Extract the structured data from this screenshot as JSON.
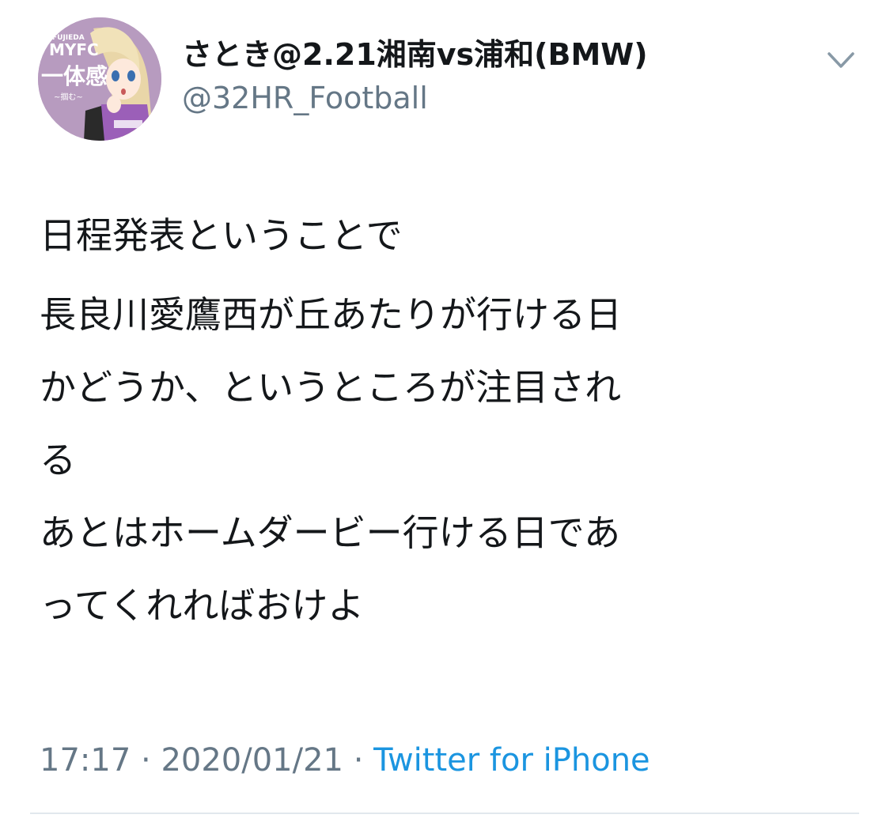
{
  "author": {
    "display_name": "さとき@2.21湘南vs浦和(BMW)",
    "handle": "@32HR_Football",
    "avatar_icon": "user-avatar",
    "avatar_text_top": "FUJIEDA",
    "avatar_text_brand": "MYFC",
    "avatar_text_main": "一体感",
    "avatar_text_sub": "~掴む~"
  },
  "menu": {
    "icon": "chevron-down-icon"
  },
  "tweet": {
    "paragraph1": "日程発表ということで",
    "paragraph2_lines": [
      "長良川愛鷹西が丘あたりが行ける日",
      "かどうか、というところが注目され",
      "る",
      "あとはホームダービー行ける日であ",
      "ってくれればおけよ"
    ]
  },
  "meta": {
    "time": "17:17",
    "separator": " · ",
    "date": "2020/01/21",
    "source": "Twitter for iPhone"
  },
  "colors": {
    "text": "#14171a",
    "secondary": "#657786",
    "link": "#1b95e0",
    "divider": "#e1e8ed",
    "avatar_bg": "#b79bbf"
  }
}
